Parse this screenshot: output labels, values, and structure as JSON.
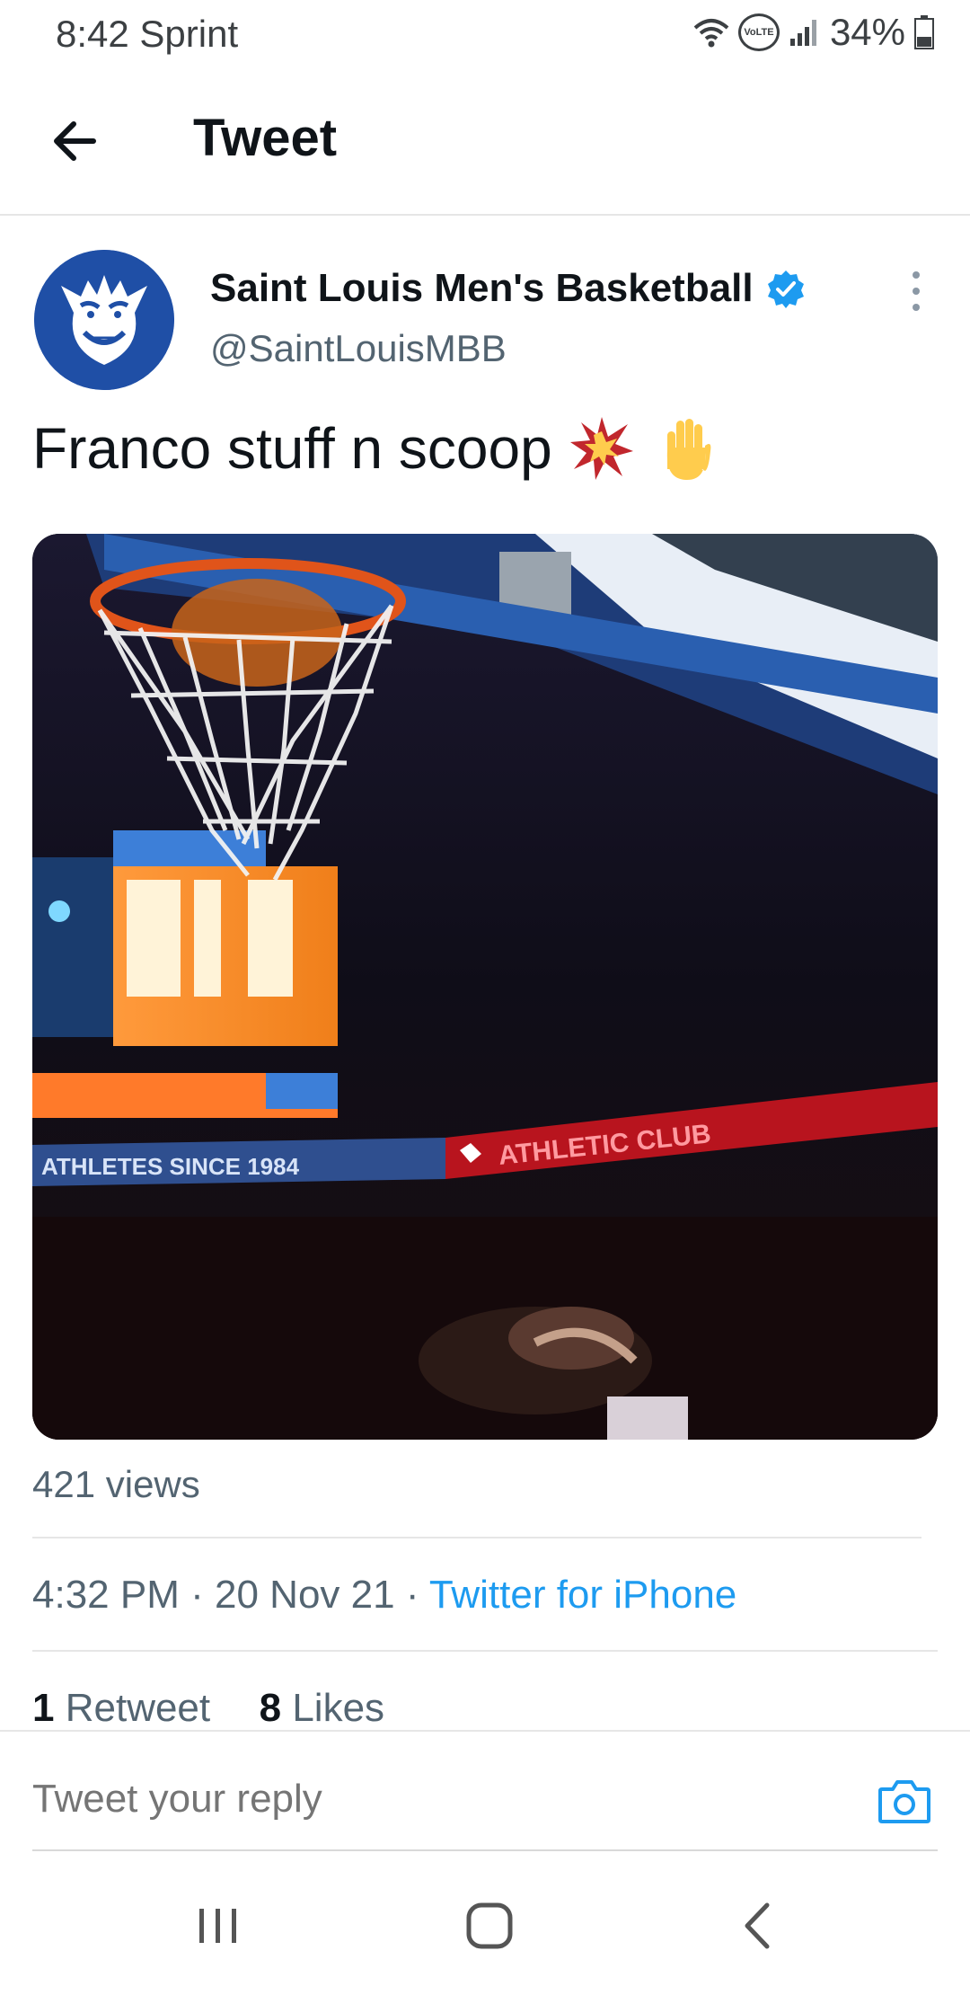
{
  "status_bar": {
    "time": "8:42",
    "carrier": "Sprint",
    "volte_label": "VoLTE",
    "battery": "34%",
    "icons": [
      "wifi-icon",
      "volte-icon",
      "signal-icon",
      "battery-icon"
    ]
  },
  "header": {
    "title": "Tweet",
    "back_icon": "back-arrow-icon"
  },
  "tweet": {
    "author_name": "Saint Louis Men's Basketball",
    "handle": "@SaintLouisMBB",
    "verified": true,
    "text": "Franco stuff n scoop",
    "emojis": [
      "collision-emoji",
      "raised-hand-emoji"
    ],
    "views": "421 views",
    "time": "4:32 PM",
    "date": "20 Nov 21",
    "source": "Twitter for iPhone",
    "retweets_count": "1",
    "retweets_label": "Retweet",
    "likes_count": "8",
    "likes_label": "Likes",
    "media_text": {
      "board_left": "ATHLETES SINCE 1984",
      "board_right": "ATHLETIC CLUB"
    }
  },
  "reply": {
    "placeholder": "Tweet your reply",
    "icon": "camera-icon"
  },
  "nav": {
    "icons": [
      "recent-apps-icon",
      "home-icon",
      "back-icon"
    ]
  },
  "colors": {
    "accent": "#1d9bf0",
    "secondary_text": "#536471",
    "primary_text": "#0f1419"
  }
}
